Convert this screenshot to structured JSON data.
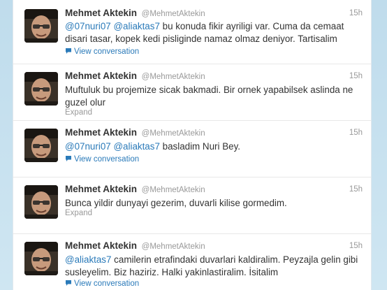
{
  "colors": {
    "link": "#2a7ab9",
    "name": "#333333",
    "meta": "#999999",
    "background": "#c0deed"
  },
  "tweets": [
    {
      "fullname": "Mehmet Aktekin",
      "username": "@MehmetAktekin",
      "time": "15h",
      "segments": [
        {
          "text": "@07nuri07",
          "mention": true
        },
        {
          "text": " ",
          "mention": false
        },
        {
          "text": "@aliaktas7",
          "mention": true
        },
        {
          "text": " bu konuda fikir ayriligi var. Cuma da cemaat disari tasar, kopek kedi pisliginde namaz olmaz deniyor. Tartisalim",
          "mention": false
        }
      ],
      "action": "View conversation",
      "action_icon": "speech-bubble-icon"
    },
    {
      "fullname": "Mehmet Aktekin",
      "username": "@MehmetAktekin",
      "time": "15h",
      "segments": [
        {
          "text": "Muftuluk bu projemize sicak bakmadi. Bir ornek yapabilsek aslinda ne guzel olur",
          "mention": false
        }
      ],
      "action": "Expand",
      "action_icon": ""
    },
    {
      "fullname": "Mehmet Aktekin",
      "username": "@MehmetAktekin",
      "time": "15h",
      "segments": [
        {
          "text": "@07nuri07",
          "mention": true
        },
        {
          "text": " ",
          "mention": false
        },
        {
          "text": "@aliaktas7",
          "mention": true
        },
        {
          "text": " basladim Nuri Bey.",
          "mention": false
        }
      ],
      "action": "View conversation",
      "action_icon": "speech-bubble-icon"
    },
    {
      "fullname": "Mehmet Aktekin",
      "username": "@MehmetAktekin",
      "time": "15h",
      "segments": [
        {
          "text": "Bunca yildir dunyayi gezerim, duvarli kilise gormedim.",
          "mention": false
        }
      ],
      "action": "Expand",
      "action_icon": ""
    },
    {
      "fullname": "Mehmet Aktekin",
      "username": "@MehmetAktekin",
      "time": "15h",
      "segments": [
        {
          "text": "@aliaktas7",
          "mention": true
        },
        {
          "text": " camilerin etrafindaki duvarlari kaldiralim. Peyzajla gelin gibi susleyelim. Biz haziriz. Halki yakinlastiralim. İsitalim",
          "mention": false
        }
      ],
      "action": "View conversation",
      "action_icon": "speech-bubble-icon"
    }
  ]
}
